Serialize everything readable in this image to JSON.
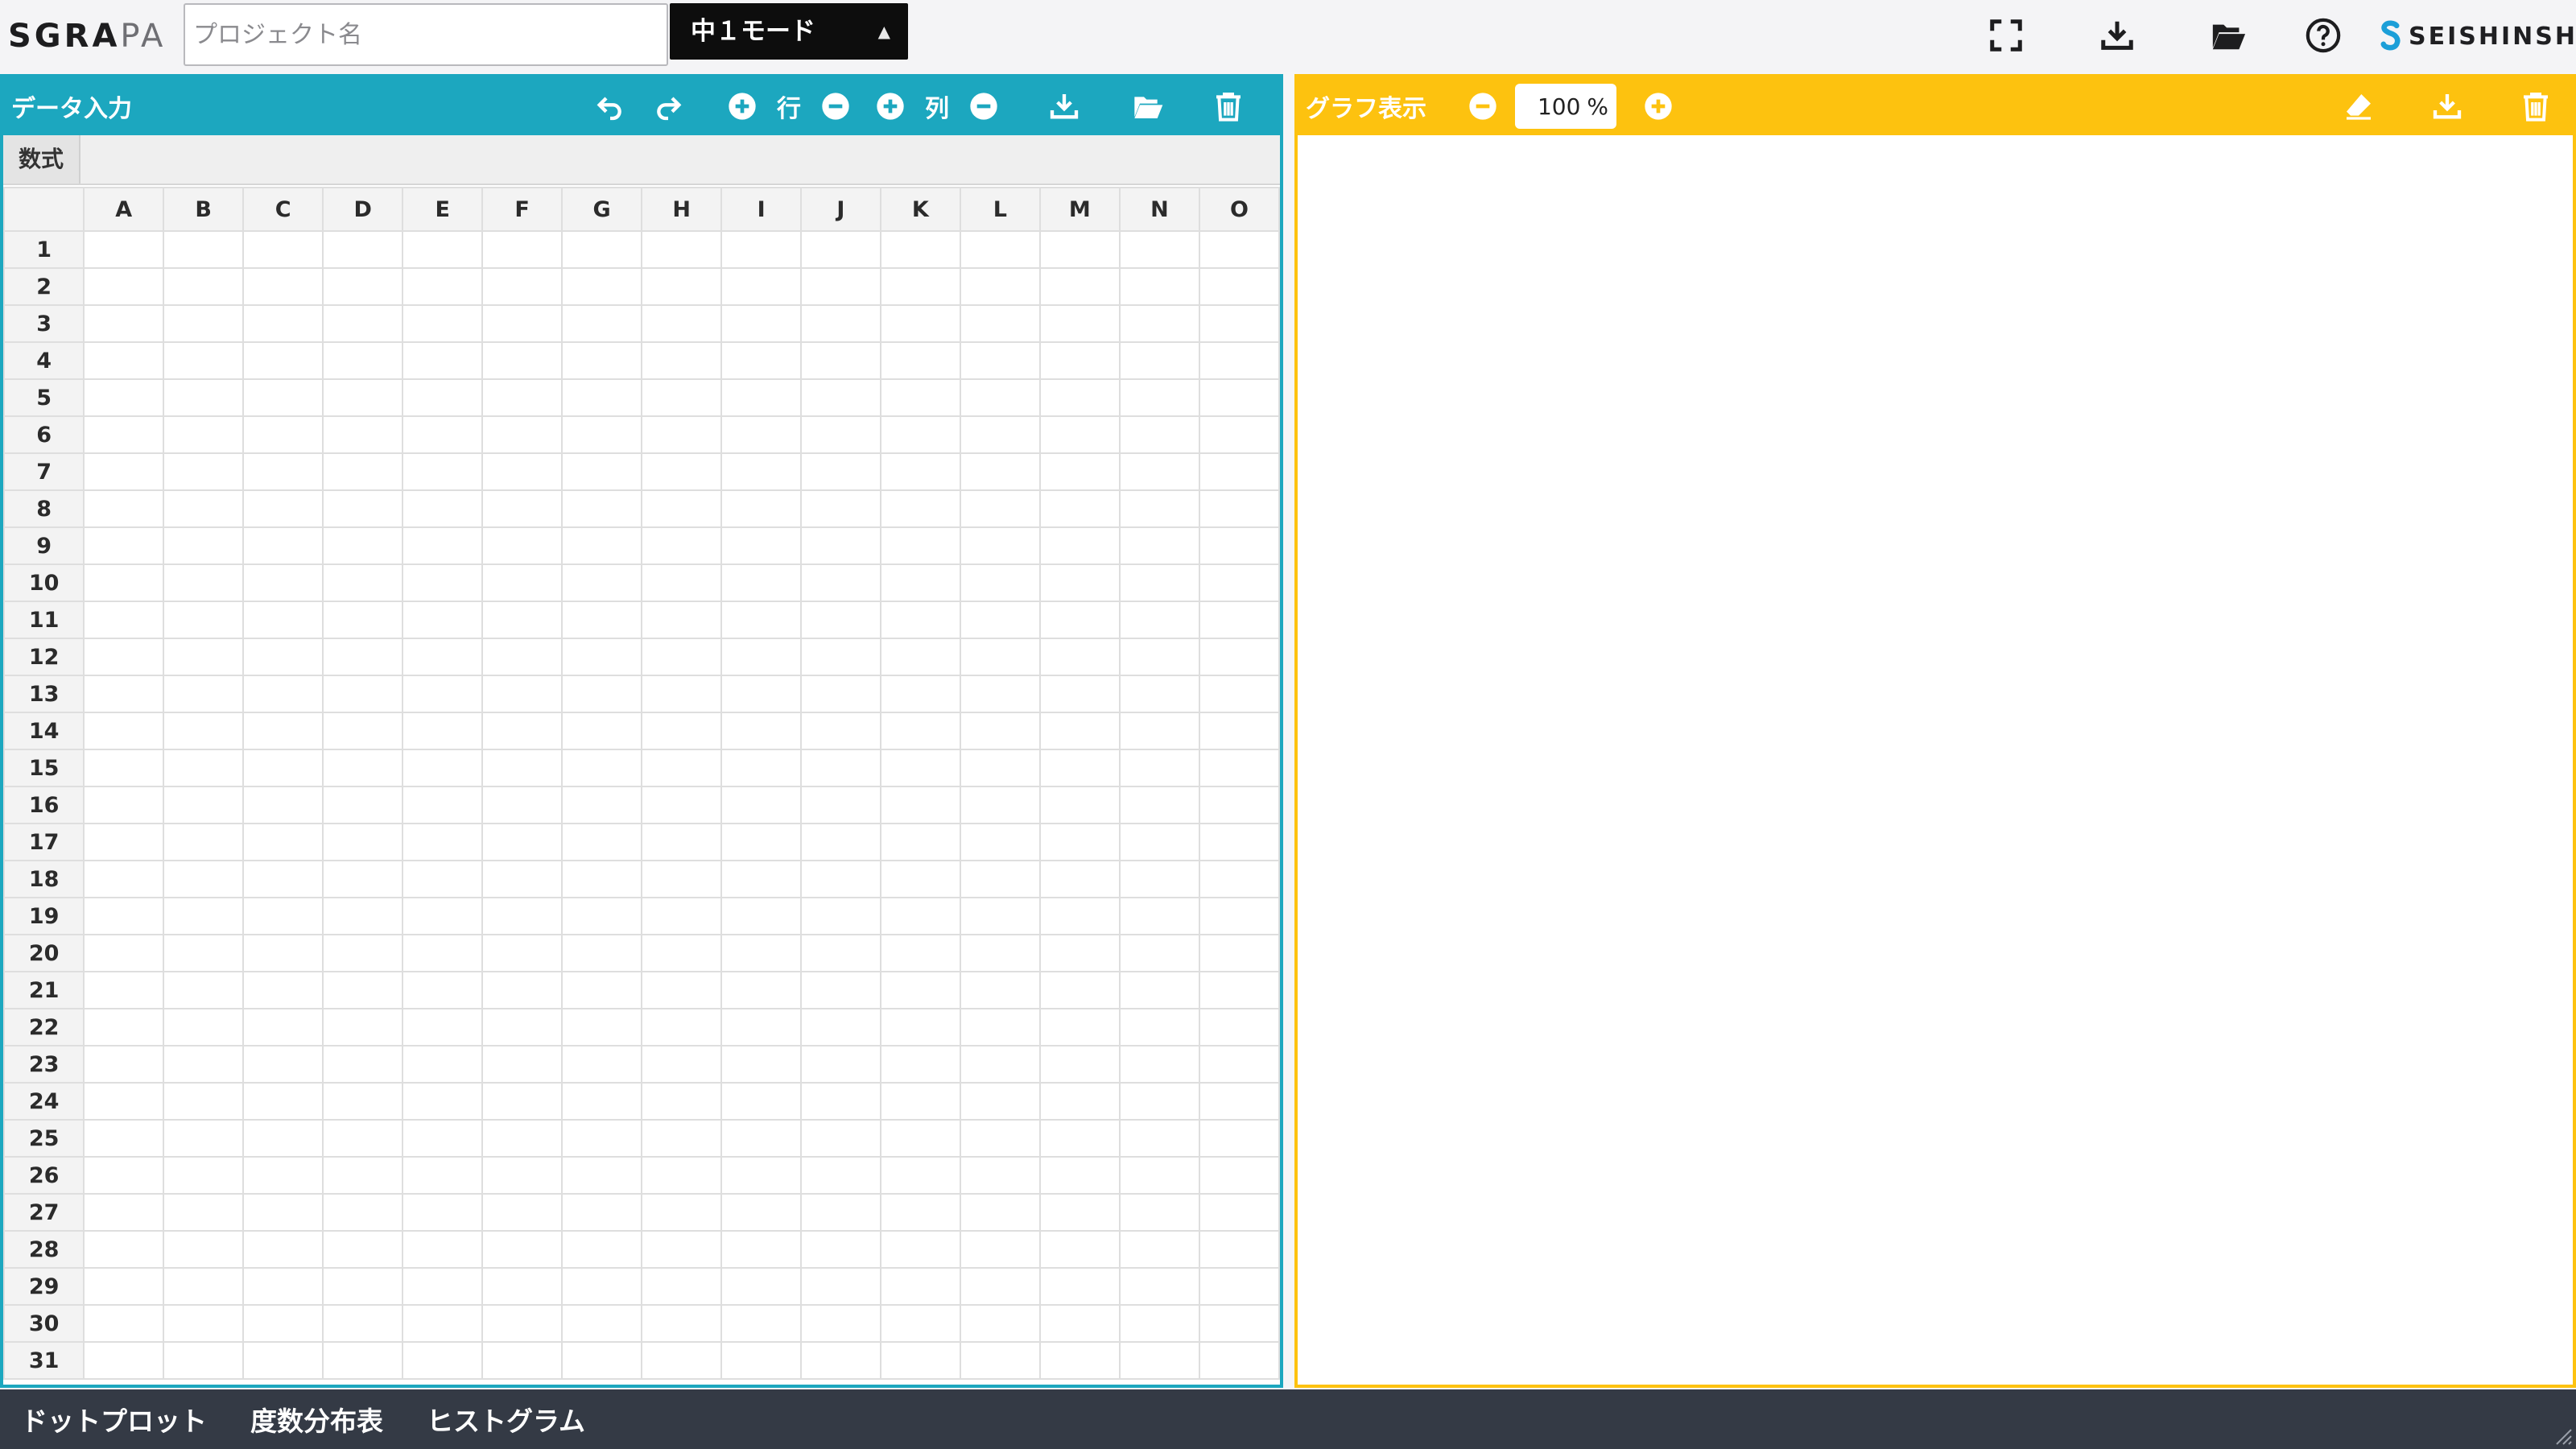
{
  "app": {
    "logo": {
      "dark": "SGRA",
      "light": "PA"
    },
    "project_name_placeholder": "プロジェクト名",
    "project_name_value": "",
    "mode": {
      "selected": "中１モード"
    },
    "brand": "SEISHINSHA"
  },
  "top_icons": [
    "fullscreen-icon",
    "download-icon",
    "folder-open-icon",
    "help-icon"
  ],
  "data_panel": {
    "title": "データ入力",
    "row_label": "行",
    "col_label": "列",
    "formula_label": "数式",
    "formula_value": "",
    "columns": [
      "A",
      "B",
      "C",
      "D",
      "E",
      "F",
      "G",
      "H",
      "I",
      "J",
      "K",
      "L",
      "M",
      "N",
      "O"
    ],
    "rows": [
      "1",
      "2",
      "3",
      "4",
      "5",
      "6",
      "7",
      "8",
      "9",
      "10",
      "11",
      "12",
      "13",
      "14",
      "15",
      "16",
      "17",
      "18",
      "19",
      "20",
      "21",
      "22",
      "23",
      "24",
      "25",
      "26",
      "27",
      "28",
      "29",
      "30",
      "31"
    ]
  },
  "graph_panel": {
    "title": "グラフ表示",
    "zoom_value": "100",
    "zoom_unit": "%"
  },
  "bottom_tabs": [
    "ドットプロット",
    "度数分布表",
    "ヒストグラム"
  ],
  "colors": {
    "data_accent": "#1ca7bf",
    "graph_accent": "#fdc20f",
    "bottom_bar": "#343a45"
  }
}
